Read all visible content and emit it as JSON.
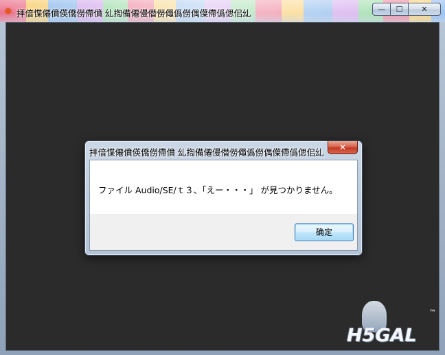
{
  "window": {
    "title": "拝偣惵僊僨偀僑僗僀僨 乣揈備僊僈僣僗僶僞僗偶僷僀僞偲佀乣",
    "app_icon": "sunburst-app-icon",
    "buttons": {
      "minimize": "—",
      "maximize": "☐",
      "close": "✕"
    }
  },
  "watermark": {
    "text": "H5GAL",
    "tm": "™"
  },
  "dialog": {
    "title": "拝偣惵僊僨偀僑僗僀僨 乣揈備僊僈僣僗僶僞僗偶僷僀僞偲佀乣",
    "close": "✕",
    "message": "ファイル Audio/SE/ｔ３、「えー・・・」 が見つかりません。",
    "ok_label": "确定"
  },
  "colors": {
    "client_background": "#2b2b2b",
    "dialog_close_red": "#c23a21",
    "button_border": "#3c7fb1"
  }
}
